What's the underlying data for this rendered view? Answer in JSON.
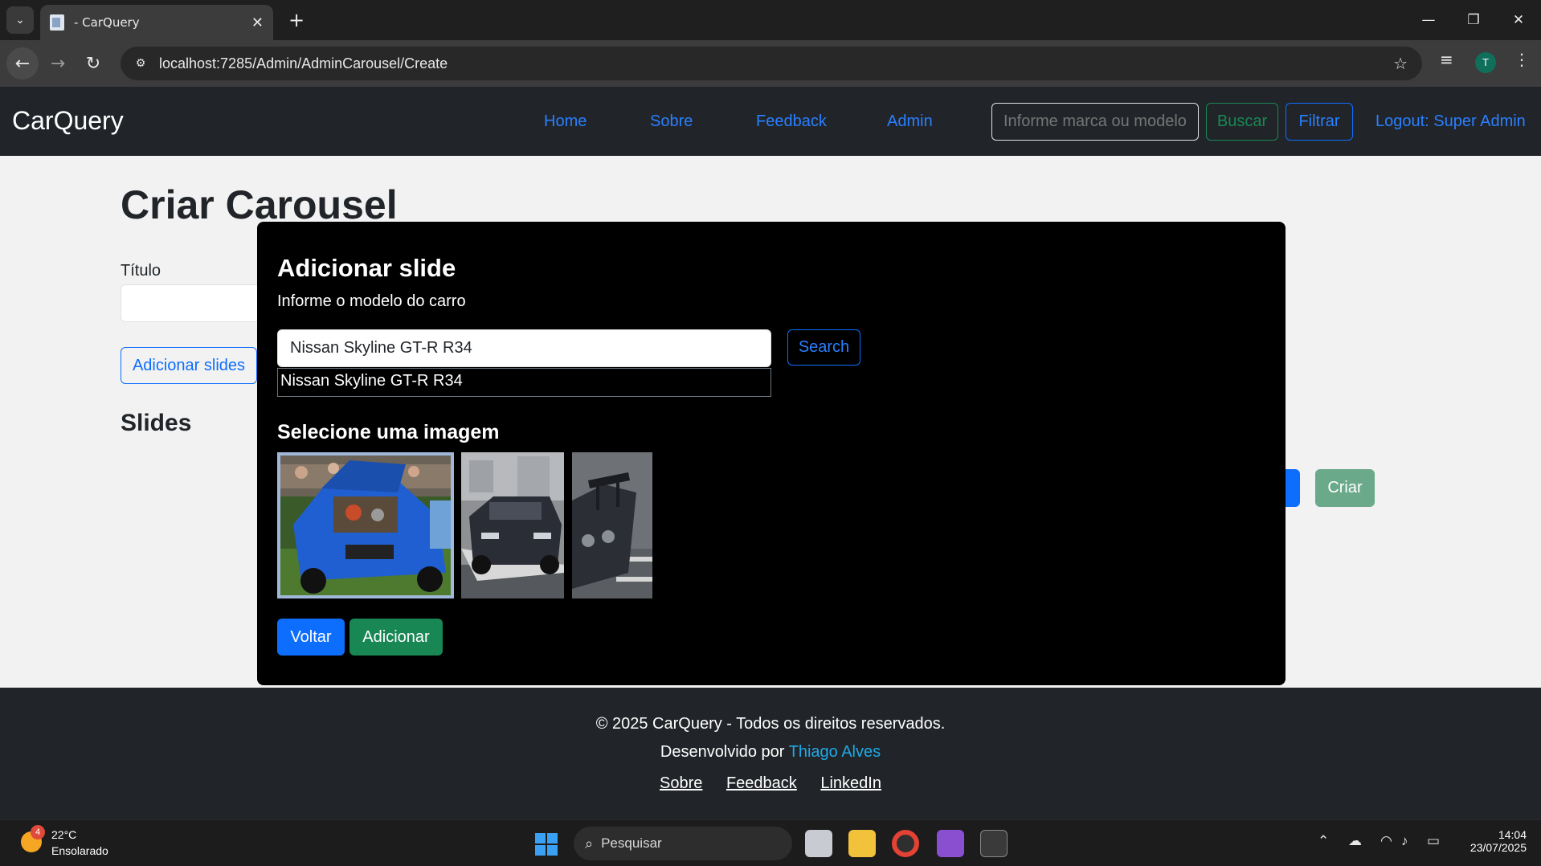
{
  "browser": {
    "tab_title": "- CarQuery",
    "tab_close": "✕",
    "new_tab": "+",
    "url": "localhost:7285/Admin/AdminCarousel/Create"
  },
  "site_nav": {
    "brand": "CarQuery",
    "links": [
      "Home",
      "Sobre",
      "Feedback",
      "Admin"
    ],
    "search_placeholder": "Informe marca ou modelo",
    "buscar_label": "Buscar",
    "filtrar_label": "Filtrar",
    "logout_label": "Logout: Super Admin"
  },
  "page": {
    "title": "Criar Carousel",
    "titulo_label": "Título",
    "add_slides_label": "Adicionar slides",
    "slides_heading": "Slides",
    "criar_label": "Criar"
  },
  "modal": {
    "title": "Adicionar slide",
    "subtitle": "Informe o modelo do carro",
    "model_value": "Nissan Skyline GT-R R34",
    "suggestion": "Nissan Skyline GT-R R34",
    "search_label": "Search",
    "select_heading": "Selecione uma imagem",
    "voltar_label": "Voltar",
    "adicionar_label": "Adicionar",
    "images": [
      {
        "name": "blue-skyline-engine-bay",
        "selected": true
      },
      {
        "name": "dark-skyline-street",
        "selected": false
      },
      {
        "name": "skyline-rear-wing",
        "selected": false
      }
    ]
  },
  "footer": {
    "copyright": "© 2025 CarQuery - Todos os direitos reservados.",
    "developed_by": "Desenvolvido por",
    "author": "Thiago Alves",
    "links": [
      "Sobre",
      "Feedback",
      "LinkedIn"
    ]
  },
  "taskbar": {
    "weather_badge": "4",
    "temperature": "22°C",
    "weather_desc": "Ensolarado",
    "search_label": "Pesquisar",
    "time": "14:04",
    "date": "23/07/2025"
  },
  "colors": {
    "primary": "#0d6efd",
    "success": "#198754",
    "navbar_bg": "#212529",
    "modal_bg": "#000000"
  }
}
